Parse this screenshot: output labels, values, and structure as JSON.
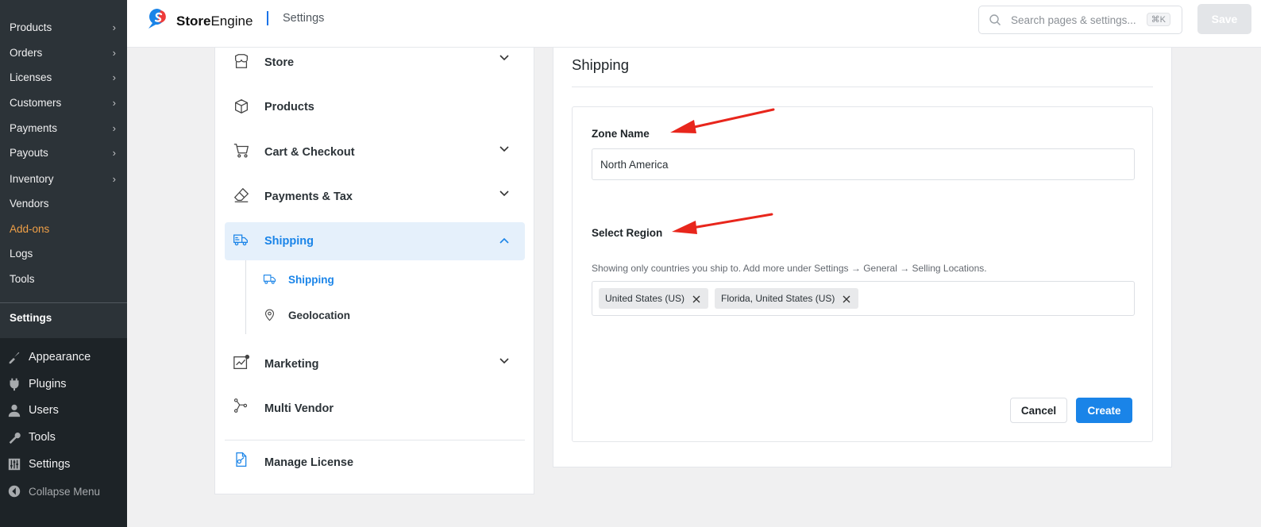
{
  "wp_sidebar": {
    "submenu": [
      {
        "label": "Products",
        "chevron": true
      },
      {
        "label": "Orders",
        "chevron": true
      },
      {
        "label": "Licenses",
        "chevron": true
      },
      {
        "label": "Customers",
        "chevron": true
      },
      {
        "label": "Payments",
        "chevron": true
      },
      {
        "label": "Payouts",
        "chevron": true
      },
      {
        "label": "Inventory",
        "chevron": true
      },
      {
        "label": "Vendors",
        "chevron": false
      },
      {
        "label": "Add-ons",
        "chevron": false
      },
      {
        "label": "Logs",
        "chevron": false
      },
      {
        "label": "Tools",
        "chevron": false
      }
    ],
    "current": "Settings",
    "top_items": [
      {
        "label": "Appearance",
        "icon": "paintbrush-icon"
      },
      {
        "label": "Plugins",
        "icon": "plug-icon"
      },
      {
        "label": "Users",
        "icon": "user-icon"
      },
      {
        "label": "Tools",
        "icon": "wrench-icon"
      },
      {
        "label": "Settings",
        "icon": "settings-sliders-icon"
      },
      {
        "label": "Collapse Menu",
        "icon": "collapse-icon"
      }
    ],
    "chevron_glyph": "›",
    "addons_color": "#f0a047"
  },
  "header": {
    "brand_strong": "Store",
    "brand_rest": "Engine",
    "page": "Settings",
    "search_placeholder": "Search pages & settings...",
    "shortcut": "⌘K",
    "save_label": "Save"
  },
  "menu": {
    "items": [
      {
        "label": "Store",
        "icon": "store-icon",
        "chevron": "down"
      },
      {
        "label": "Products",
        "icon": "box-icon",
        "chevron": ""
      },
      {
        "label": "Cart & Checkout",
        "icon": "cart-icon",
        "chevron": "down"
      },
      {
        "label": "Payments & Tax",
        "icon": "eraser-icon",
        "chevron": "down"
      },
      {
        "label": "Shipping",
        "icon": "truck-icon",
        "chevron": "up",
        "active": true
      },
      {
        "label": "Marketing",
        "icon": "chart-icon",
        "chevron": "down"
      },
      {
        "label": "Multi Vendor",
        "icon": "network-icon",
        "chevron": ""
      },
      {
        "label": "Manage License",
        "icon": "license-icon",
        "chevron": ""
      }
    ],
    "shipping_sub": [
      {
        "label": "Shipping",
        "icon": "truck-icon",
        "active": true
      },
      {
        "label": "Geolocation",
        "icon": "map-pin-icon"
      }
    ]
  },
  "content": {
    "title": "Shipping",
    "zone_label": "Zone Name",
    "zone_value": "North America",
    "region_label": "Select Region",
    "region_help": "Showing only countries you ship to. Add more under Settings → General → Selling Locations.",
    "regions": [
      "United States (US)",
      "Florida, United States (US)"
    ],
    "cancel_label": "Cancel",
    "create_label": "Create"
  },
  "colors": {
    "accent": "#1a84e8",
    "active_bg": "#e5f0fb",
    "wp_dark": "#1d2327",
    "annotation_arrow": "#e8261c"
  }
}
